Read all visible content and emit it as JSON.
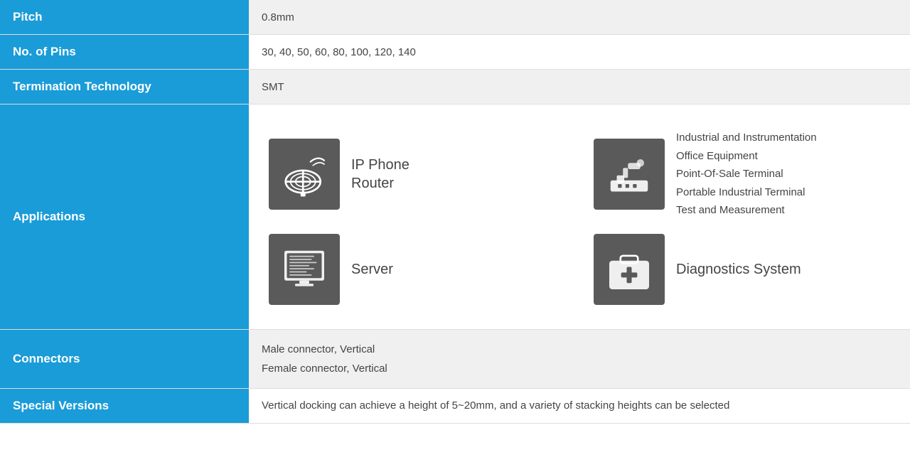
{
  "rows": {
    "pitch": {
      "label": "Pitch",
      "value": "0.8mm"
    },
    "pins": {
      "label": "No. of Pins",
      "value": "30, 40, 50, 60, 80, 100, 120, 140"
    },
    "termination": {
      "label": "Termination Technology",
      "value": "SMT"
    },
    "applications": {
      "label": "Applications",
      "items": [
        {
          "label": "IP Phone\nRouter",
          "type": "satellite"
        },
        {
          "label_multi": [
            "Industrial and Instrumentation",
            "Office Equipment",
            "Point-Of-Sale Terminal",
            "Portable Industrial Terminal",
            "Test and Measurement"
          ],
          "type": "industrial"
        },
        {
          "label": "Server",
          "type": "server"
        },
        {
          "label": "Diagnostics System",
          "type": "diagnostics"
        }
      ]
    },
    "connectors": {
      "label": "Connectors",
      "line1": "Male connector, Vertical",
      "line2": "Female connector, Vertical"
    },
    "special": {
      "label": "Special Versions",
      "value": "Vertical docking can achieve a height of 5~20mm, and a variety of stacking heights can be selected"
    }
  }
}
